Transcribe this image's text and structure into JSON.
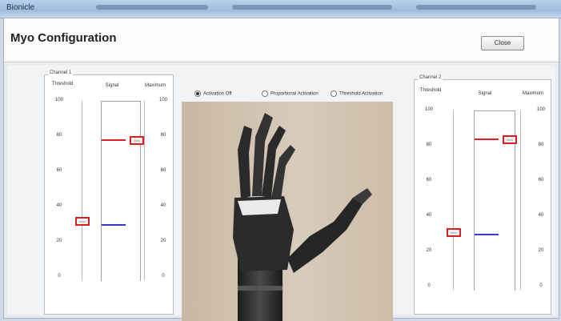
{
  "window": {
    "title": "Bionicle"
  },
  "header": {
    "title": "Myo Configuration",
    "close_label": "Close"
  },
  "modes": [
    {
      "label": "Activation Off",
      "selected": true
    },
    {
      "label": "Proportional Activation",
      "selected": false
    },
    {
      "label": "Threshold Activation",
      "selected": false
    }
  ],
  "channel1": {
    "label": "Channel 1",
    "col_threshold": "Threshold",
    "col_signal": "Signal",
    "col_maximum": "Maximum",
    "ticks": [
      "100",
      "80",
      "60",
      "40",
      "20",
      "0"
    ],
    "threshold_value": 33,
    "maximum_value": 78,
    "signal_value": 31
  },
  "channel2": {
    "label": "Channel 2",
    "col_threshold": "Threshold",
    "col_signal": "Signal",
    "col_maximum": "Maximum",
    "ticks": [
      "100",
      "80",
      "60",
      "40",
      "20",
      "0"
    ],
    "threshold_value": 32,
    "maximum_value": 84,
    "signal_value": 31
  },
  "colors": {
    "threshold_line": "#e11b22",
    "signal_line": "#3b33d8",
    "handle_border": "#d81e1e"
  },
  "image": {
    "subject": "prosthetic robotic hand"
  }
}
